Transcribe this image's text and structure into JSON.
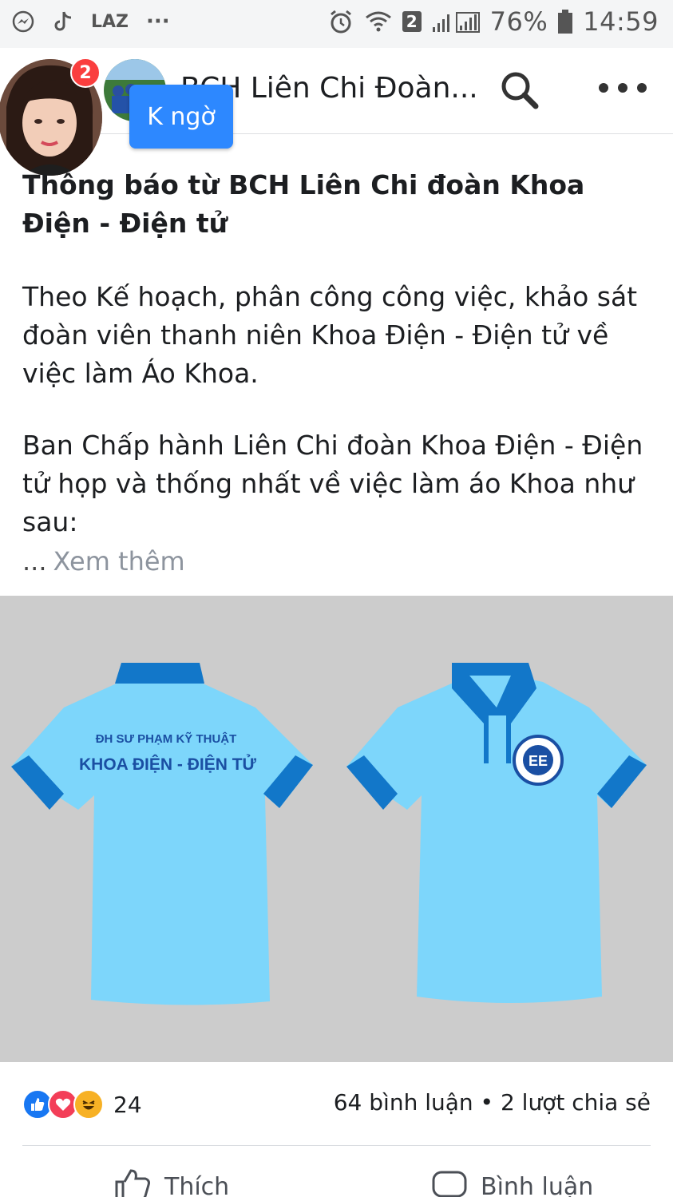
{
  "status_bar": {
    "left_icons": [
      "messenger-icon",
      "tiktok-icon",
      "lazada-icon",
      "more-dots-icon"
    ],
    "lazada_label": "LAZ",
    "overflow_label": "···",
    "sim_badge": "2",
    "battery_percent": "76%",
    "time": "14:59"
  },
  "header": {
    "title": "BCH Liên Chi Đoàn...",
    "search_icon": "search-icon",
    "more_icon": "more-horizontal-icon"
  },
  "chat_heads": {
    "unread_count": "2",
    "tooltip": "K ngờ"
  },
  "post": {
    "heading": "Thông báo từ BCH Liên Chi đoàn Khoa Điện - Điện tử",
    "paragraph1": "Theo Kế hoạch, phân công công việc, khảo sát đoàn viên thanh niên Khoa Điện - Điện tử về việc làm Áo Khoa.",
    "paragraph2": "Ban Chấp hành Liên Chi đoàn Khoa Điện - Điện tử họp và thống nhất về việc làm áo Khoa như sau:",
    "see_more_dots": "...",
    "see_more": "Xem thêm"
  },
  "image": {
    "shirt_back_line1": "ĐH SƯ PHẠM KỸ THUẬT",
    "shirt_back_line2": "KHOA ĐIỆN - ĐIỆN TỬ",
    "logo_text": "EE",
    "colors": {
      "background": "#cccccc",
      "shirt": "#7dd6fb",
      "trim": "#1277c9"
    }
  },
  "engagement": {
    "reaction_icons": [
      "like-reaction-icon",
      "love-reaction-icon",
      "haha-reaction-icon"
    ],
    "reaction_count": "24",
    "stats": "64 bình luận • 2 lượt chia sẻ"
  },
  "actions": {
    "like_label": "Thích",
    "comment_label": "Bình luận"
  }
}
